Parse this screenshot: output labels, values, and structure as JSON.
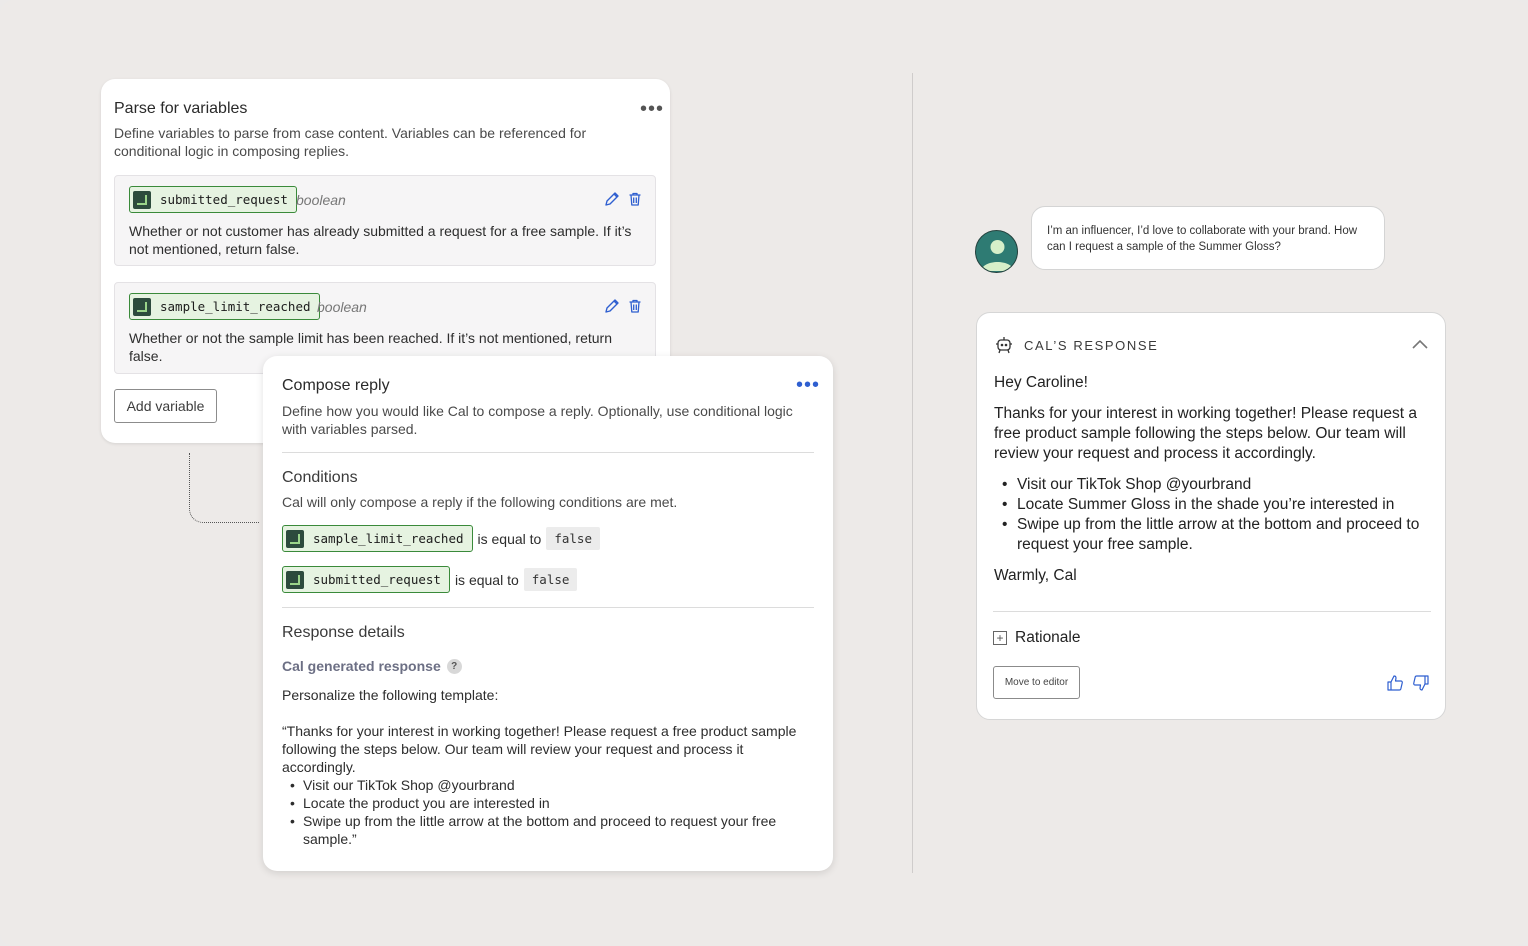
{
  "parse_card": {
    "title": "Parse for variables",
    "description": "Define variables to parse from case content. Variables can be referenced for conditional logic in composing replies.",
    "variables": [
      {
        "name": "submitted_request",
        "type": "boolean",
        "description": "Whether or not customer has already submitted a request for a free sample. If it’s not mentioned, return false."
      },
      {
        "name": "sample_limit_reached",
        "type": "boolean",
        "description": "Whether or not the sample limit has been reached. If it’s not mentioned, return false."
      }
    ],
    "add_variable_label": "Add variable",
    "more_label": "•••"
  },
  "compose_card": {
    "title": "Compose reply",
    "description": "Define how you would like Cal to compose a reply. Optionally, use conditional logic with variables parsed.",
    "more_label": "•••",
    "conditions_title": "Conditions",
    "conditions_desc": "Cal will only compose a reply if the following conditions are met.",
    "conditions": [
      {
        "variable": "sample_limit_reached",
        "operator": "is equal to",
        "value": "false"
      },
      {
        "variable": "submitted_request",
        "operator": "is equal to",
        "value": "false"
      }
    ],
    "response_details_title": "Response details",
    "generated_label": "Cal generated response",
    "help_label": "?",
    "template_intro": "Personalize the following template:",
    "template_body": "“Thanks for your interest in working together! Please request a free product sample following the steps below. Our team will review your request and process it accordingly.",
    "template_items": [
      "Visit our TikTok Shop @yourbrand",
      "Locate the product you are interested in",
      "Swipe up from the little arrow at the bottom and proceed to request your free sample.”"
    ]
  },
  "chat": {
    "customer_message": "I’m an influencer, I’d love to collaborate with your brand. How can I request a sample of the Summer Gloss?",
    "response_header": "CAL’S RESPONSE",
    "greeting": "Hey Caroline!",
    "paragraph": "Thanks for your interest in working together! Please request a free product sample following the steps below. Our team will review your request and process it accordingly.",
    "steps": [
      "Visit our TikTok Shop @yourbrand",
      "Locate Summer Gloss in the shade you’re interested in",
      "Swipe up from the little arrow at the bottom and proceed to request your free sample."
    ],
    "signoff": "Warmly, Cal",
    "rationale_label": "Rationale",
    "rationale_toggle": "+",
    "move_to_editor_label": "Move to editor"
  },
  "colors": {
    "accent_blue": "#2f5fd0",
    "chip_green": "#3a8a3a",
    "chip_bg": "#e6f3e1",
    "avatar_teal": "#2e7b73"
  }
}
